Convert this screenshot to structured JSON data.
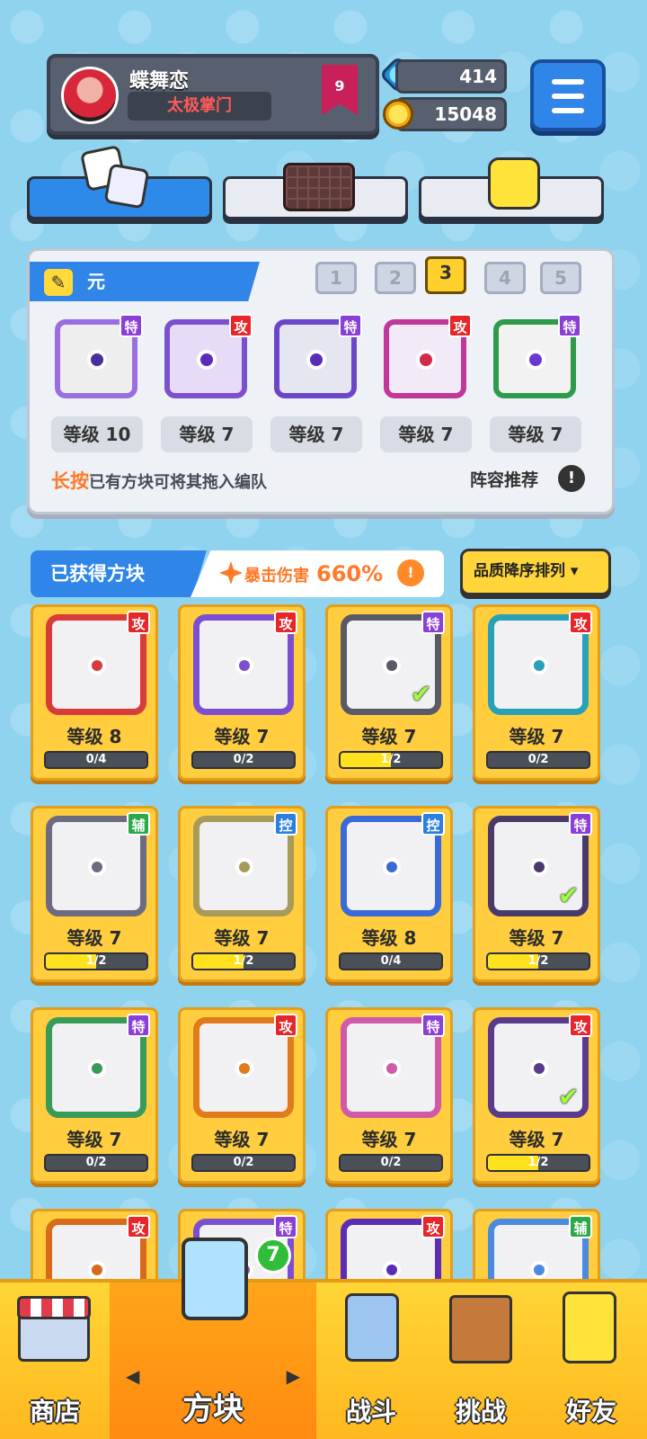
{
  "profile": {
    "name": "蝶舞恋",
    "title": "太极掌门",
    "rank": "9"
  },
  "currency": {
    "gems": "414",
    "coins": "15048"
  },
  "deck": {
    "label": "元",
    "slots": [
      "1",
      "2",
      "3",
      "4",
      "5"
    ],
    "active_slot": 3,
    "cards": [
      {
        "tag": "特",
        "level": "等级 10"
      },
      {
        "tag": "攻",
        "level": "等级 7"
      },
      {
        "tag": "特",
        "level": "等级 7"
      },
      {
        "tag": "攻",
        "level": "等级 7"
      },
      {
        "tag": "特",
        "level": "等级 7"
      }
    ],
    "tip_highlight": "长按",
    "tip_rest": "已有方块可将其拖入编队",
    "recommend": "阵容推荐",
    "info": "!"
  },
  "obtained": {
    "title": "已获得方块",
    "crit_label": "暴击伤害",
    "crit_value": "660%",
    "info": "!",
    "sort_label": "品质降序排列 ▾"
  },
  "cards": [
    {
      "tag": "攻",
      "level": "等级 8",
      "progress": "0/4"
    },
    {
      "tag": "攻",
      "level": "等级 7",
      "progress": "0/2"
    },
    {
      "tag": "特",
      "level": "等级 7",
      "progress": "1/2"
    },
    {
      "tag": "攻",
      "level": "等级 7",
      "progress": "0/2"
    },
    {
      "tag": "辅",
      "level": "等级 7",
      "progress": "1/2"
    },
    {
      "tag": "控",
      "level": "等级 7",
      "progress": "1/2"
    },
    {
      "tag": "控",
      "level": "等级 8",
      "progress": "0/4"
    },
    {
      "tag": "特",
      "level": "等级 7",
      "progress": "1/2"
    },
    {
      "tag": "特",
      "level": "等级 7",
      "progress": "0/2"
    },
    {
      "tag": "攻",
      "level": "等级 7",
      "progress": "0/2"
    },
    {
      "tag": "特",
      "level": "等级 7",
      "progress": "0/2"
    },
    {
      "tag": "攻",
      "level": "等级 7",
      "progress": "1/2"
    },
    {
      "tag": "攻"
    },
    {
      "tag": "特"
    },
    {
      "tag": "攻"
    },
    {
      "tag": "辅"
    }
  ],
  "nav": {
    "shop": "商店",
    "blocks": "方块",
    "battle": "战斗",
    "challenge": "挑战",
    "friends": "好友",
    "badge": "7",
    "prev_arrow": "◀",
    "next_arrow": "▶"
  },
  "colors": {
    "tag_attack": "#e8262a",
    "tag_special": "#8a3fd6",
    "tag_support": "#2fa84a",
    "tag_control": "#2a7fe0"
  }
}
